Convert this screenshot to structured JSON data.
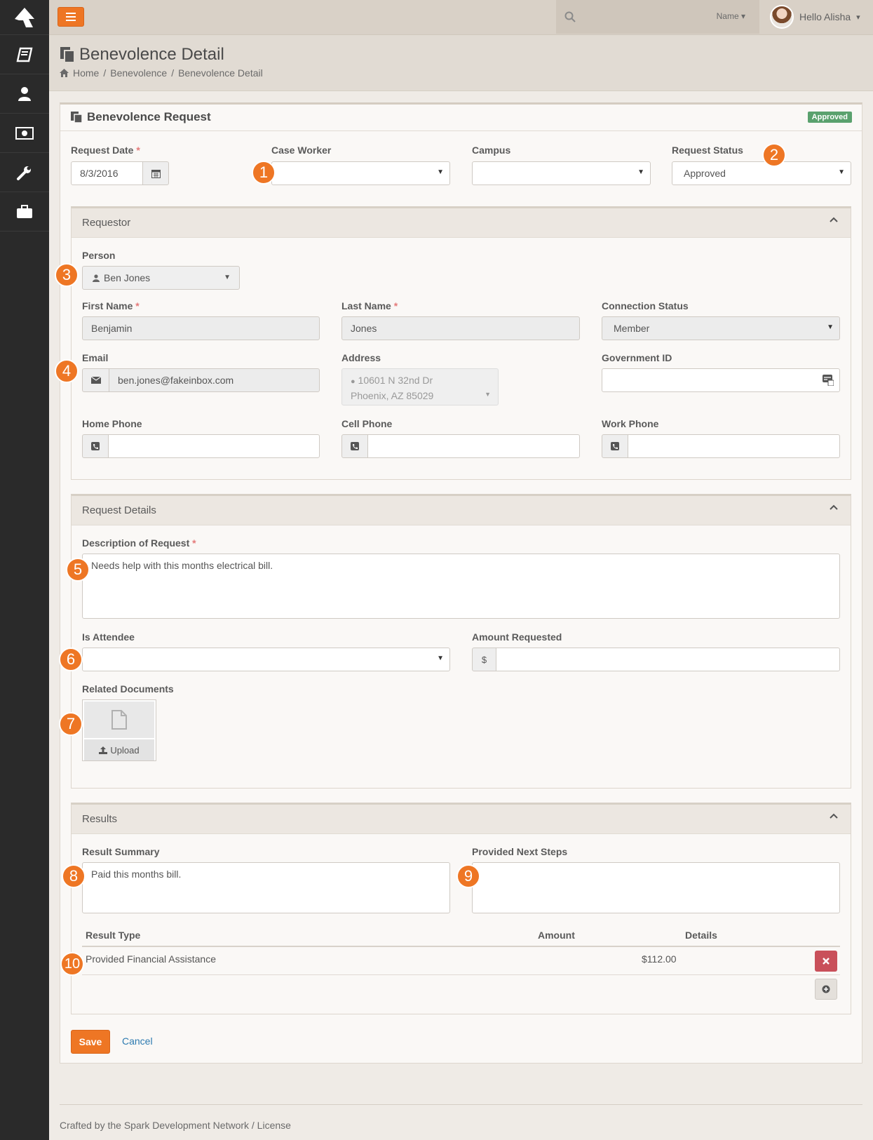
{
  "topbar": {
    "search_filter": "Name",
    "user_greeting": "Hello Alisha"
  },
  "page": {
    "title": "Benevolence Detail",
    "breadcrumb": [
      "Home",
      "Benevolence",
      "Benevolence Detail"
    ]
  },
  "panel": {
    "title": "Benevolence Request",
    "status_badge": "Approved"
  },
  "form": {
    "request_date_label": "Request Date",
    "request_date_value": "8/3/2016",
    "case_worker_label": "Case Worker",
    "case_worker_value": "",
    "campus_label": "Campus",
    "campus_value": "",
    "request_status_label": "Request Status",
    "request_status_value": "Approved"
  },
  "requestor": {
    "section_title": "Requestor",
    "person_label": "Person",
    "person_value": "Ben Jones",
    "first_name_label": "First Name",
    "first_name_value": "Benjamin",
    "last_name_label": "Last Name",
    "last_name_value": "Jones",
    "connection_status_label": "Connection Status",
    "connection_status_value": "Member",
    "email_label": "Email",
    "email_value": "ben.jones@fakeinbox.com",
    "address_label": "Address",
    "address_line1": "10601 N 32nd Dr",
    "address_line2": "Phoenix, AZ 85029",
    "government_id_label": "Government ID",
    "government_id_value": "",
    "home_phone_label": "Home Phone",
    "cell_phone_label": "Cell Phone",
    "work_phone_label": "Work Phone"
  },
  "details": {
    "section_title": "Request Details",
    "description_label": "Description of Request",
    "description_value": "Needs help with this months electrical bill.",
    "is_attendee_label": "Is Attendee",
    "is_attendee_value": "",
    "amount_requested_label": "Amount Requested",
    "currency_symbol": "$",
    "amount_requested_value": "",
    "related_documents_label": "Related Documents",
    "upload_label": "Upload"
  },
  "results": {
    "section_title": "Results",
    "result_summary_label": "Result Summary",
    "result_summary_value": "Paid this months bill.",
    "next_steps_label": "Provided Next Steps",
    "next_steps_value": "",
    "columns": [
      "Result Type",
      "Amount",
      "Details"
    ],
    "rows": [
      {
        "result_type": "Provided Financial Assistance",
        "amount": "$112.00",
        "details": ""
      }
    ]
  },
  "actions": {
    "save_label": "Save",
    "cancel_label": "Cancel"
  },
  "footer": {
    "text": "Crafted by the Spark Development Network / License"
  },
  "callouts": [
    "1",
    "2",
    "3",
    "4",
    "5",
    "6",
    "7",
    "8",
    "9",
    "10"
  ],
  "colors": {
    "accent": "#ee7624",
    "approved": "#5aa16e",
    "danger": "#c9505a",
    "sidebar": "#2a2a2a"
  }
}
